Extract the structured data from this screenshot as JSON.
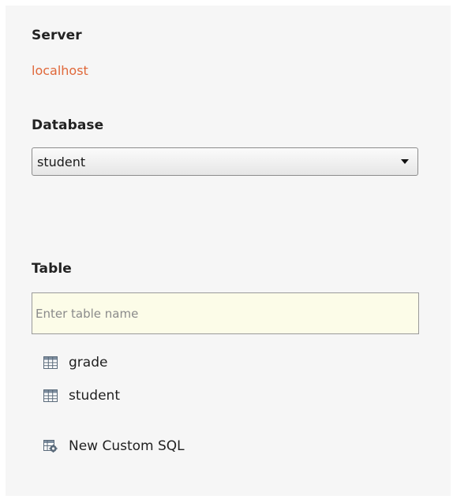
{
  "server": {
    "heading": "Server",
    "value": "localhost"
  },
  "database": {
    "heading": "Database",
    "selected": "student"
  },
  "table": {
    "heading": "Table",
    "search_placeholder": "Enter table name",
    "items": [
      {
        "label": "grade",
        "icon": "table-icon"
      },
      {
        "label": "student",
        "icon": "table-icon"
      }
    ],
    "custom_sql": {
      "label": "New Custom SQL",
      "icon": "custom-sql-icon"
    }
  },
  "colors": {
    "server_value": "#e0683a",
    "input_background": "#fcfce8",
    "panel_background": "#f6f6f6"
  }
}
